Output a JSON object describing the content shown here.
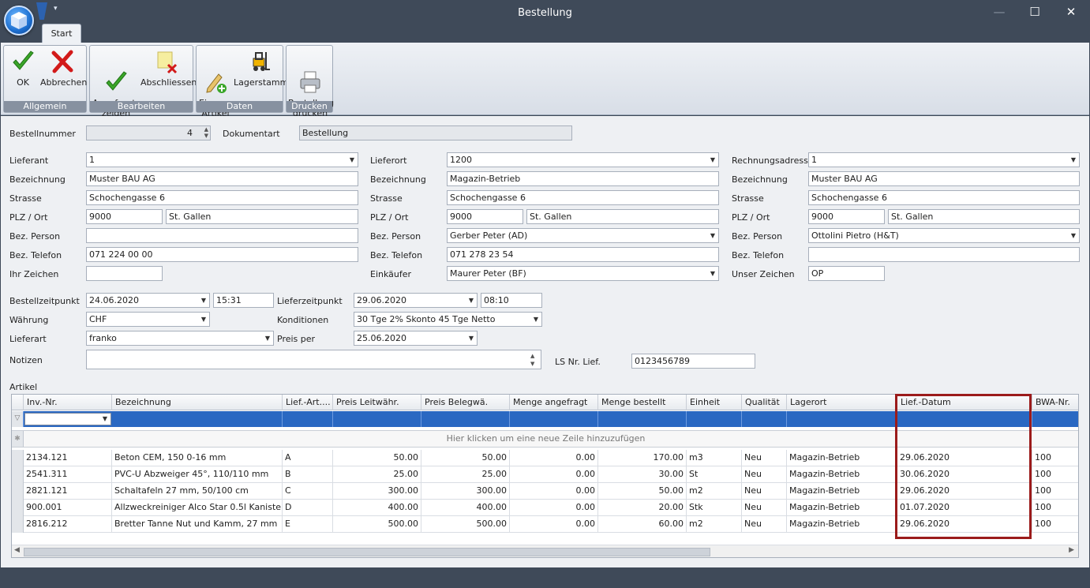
{
  "window": {
    "title": "Bestellung"
  },
  "tabs": [
    {
      "label": "Start"
    }
  ],
  "ribbon": {
    "groups": [
      {
        "label": "Allgemein",
        "buttons": [
          {
            "label": "OK",
            "icon": "check-icon"
          },
          {
            "label": "Abbrechen",
            "icon": "red-x-icon"
          }
        ]
      },
      {
        "label": "Bearbeiten",
        "buttons": [
          {
            "label": "Angefragte\nzeigen",
            "icon": "check-icon"
          },
          {
            "label": "Abschliessen",
            "icon": "note-delete-icon"
          }
        ]
      },
      {
        "label": "Daten",
        "buttons": [
          {
            "label": "Eigener\nArtikel",
            "icon": "pencil-add-icon"
          },
          {
            "label": "Lagerstamm",
            "icon": "forklift-icon"
          }
        ]
      },
      {
        "label": "Drucken",
        "buttons": [
          {
            "label": "Bestellung\ndrucken",
            "icon": "printer-icon"
          }
        ]
      }
    ]
  },
  "header": {
    "bestellnummer_label": "Bestellnummer",
    "bestellnummer": "4",
    "dokumentart_label": "Dokumentart",
    "dokumentart": "Bestellung"
  },
  "lieferant": {
    "lieferant_label": "Lieferant",
    "lieferant": "1",
    "bezeichnung_label": "Bezeichnung",
    "bezeichnung": "Muster BAU AG",
    "strasse_label": "Strasse",
    "strasse": "Schochengasse 6",
    "plzort_label": "PLZ / Ort",
    "plz": "9000",
    "ort": "St. Gallen",
    "bezperson_label": "Bez. Person",
    "bezperson": "",
    "beztelefon_label": "Bez. Telefon",
    "beztelefon": "071 224 00 00",
    "zeichen_label": "Ihr Zeichen",
    "zeichen": ""
  },
  "lieferort": {
    "lieferort_label": "Lieferort",
    "lieferort": "1200",
    "bezeichnung_label": "Bezeichnung",
    "bezeichnung": "Magazin-Betrieb",
    "strasse_label": "Strasse",
    "strasse": "Schochengasse 6",
    "plzort_label": "PLZ / Ort",
    "plz": "9000",
    "ort": "St. Gallen",
    "bezperson_label": "Bez. Person",
    "bezperson": "Gerber Peter (AD)",
    "beztelefon_label": "Bez. Telefon",
    "beztelefon": "071 278 23 54",
    "einkaeufer_label": "Einkäufer",
    "einkaeufer": "Maurer Peter (BF)"
  },
  "rechnung": {
    "rechnungsadresse_label": "Rechnungsadresse",
    "rechnungsadresse": "1",
    "bezeichnung_label": "Bezeichnung",
    "bezeichnung": "Muster BAU AG",
    "strasse_label": "Strasse",
    "strasse": "Schochengasse 6",
    "plzort_label": "PLZ / Ort",
    "plz": "9000",
    "ort": "St. Gallen",
    "bezperson_label": "Bez. Person",
    "bezperson": "Ottolini Pietro (H&T)",
    "beztelefon_label": "Bez. Telefon",
    "beztelefon": "",
    "zeichen_label": "Unser Zeichen",
    "zeichen": "OP"
  },
  "order": {
    "bestellzeitpunkt_label": "Bestellzeitpunkt",
    "bestelldatum": "24.06.2020",
    "bestellzeit": "15:31",
    "lieferzeitpunkt_label": "Lieferzeitpunkt",
    "lieferdatum": "29.06.2020",
    "lieferzeit": "08:10",
    "waehrung_label": "Währung",
    "waehrung": "CHF",
    "konditionen_label": "Konditionen",
    "konditionen": "30 Tge 2% Skonto 45 Tge Netto",
    "lieferart_label": "Lieferart",
    "lieferart": "franko",
    "preisper_label": "Preis per",
    "preisper": "25.06.2020",
    "notizen_label": "Notizen",
    "notizen": "",
    "lsnr_label": "LS Nr. Lief.",
    "lsnr": "0123456789"
  },
  "artikel": {
    "label": "Artikel",
    "new_row_text": "Hier klicken um eine neue Zeile hinzuzufügen",
    "columns": [
      "Inv.-Nr.",
      "Bezeichnung",
      "Lief.-Art....",
      "Preis Leitwähr.",
      "Preis Belegwä.",
      "Menge angefragt",
      "Menge bestellt",
      "Einheit",
      "Qualität",
      "Lagerort",
      "Lief.-Datum",
      "BWA-Nr."
    ],
    "rows": [
      [
        "2134.121",
        "Beton CEM, 150  0-16 mm",
        "A",
        "50.00",
        "50.00",
        "0.00",
        "170.00",
        "m3",
        "Neu",
        "Magazin-Betrieb",
        "29.06.2020",
        "100"
      ],
      [
        "2541.311",
        "PVC-U Abzweiger 45°, 110/110 mm",
        "B",
        "25.00",
        "25.00",
        "0.00",
        "30.00",
        "St",
        "Neu",
        "Magazin-Betrieb",
        "30.06.2020",
        "100"
      ],
      [
        "2821.121",
        "Schaltafeln 27 mm, 50/100 cm",
        "C",
        "300.00",
        "300.00",
        "0.00",
        "50.00",
        "m2",
        "Neu",
        "Magazin-Betrieb",
        "29.06.2020",
        "100"
      ],
      [
        "900.001",
        "Allzweckreiniger Alco Star 0.5l Kanister",
        "D",
        "400.00",
        "400.00",
        "0.00",
        "20.00",
        "Stk",
        "Neu",
        "Magazin-Betrieb",
        "01.07.2020",
        "100"
      ],
      [
        "2816.212",
        "Bretter Tanne Nut und Kamm, 27 mm",
        "E",
        "500.00",
        "500.00",
        "0.00",
        "60.00",
        "m2",
        "Neu",
        "Magazin-Betrieb",
        "29.06.2020",
        "100"
      ]
    ]
  },
  "colors": {
    "accent": "#2a68c2",
    "highlight": "#9b1b1b",
    "chrome": "#3f4a59"
  }
}
